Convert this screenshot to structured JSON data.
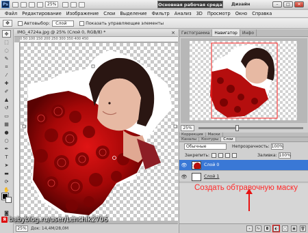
{
  "topbar": {
    "logo": "Ps",
    "zoom": "25%",
    "workspace": "Основная рабочая среда",
    "design": "Дизайн",
    "min": "–",
    "max": "□",
    "close": "✕"
  },
  "menu": [
    "Файл",
    "Редактирование",
    "Изображение",
    "Слои",
    "Выделение",
    "Фильтр",
    "Анализ",
    "3D",
    "Просмотр",
    "Окно",
    "Справка"
  ],
  "options": {
    "autoselect": "Автовыбор:",
    "autoselect_value": "Слой",
    "show_controls": "Показать управляющие элементы"
  },
  "document": {
    "tab": "IMG_4724a.jpg @ 25% (Слой 0, RGB/8) *",
    "close": "×",
    "ruler": "0   50   100   150   200   250   300   350   400   450",
    "zoom": "25%",
    "info": "Док: 14,4M/28,0M"
  },
  "watermark": {
    "badge": "Я",
    "text": "babyblog.ru/user/Lenchik2706"
  },
  "navigator": {
    "tabs": [
      "Гистограмма",
      "Навигатор",
      "Инфо"
    ],
    "active_tab": "Навигатор",
    "zoom": "25%",
    "zoom_fraction": 0.35
  },
  "layers": {
    "tabs": [
      "Коррекция",
      "Маски"
    ],
    "tabs2": [
      "Каналы",
      "Контуры",
      "Слои"
    ],
    "active_tab": "Слои",
    "blend_mode": "Обычные",
    "opacity_label": "Непрозрачность:",
    "opacity": "100%",
    "lock_label": "Закрепить:",
    "fill_label": "Заливка:",
    "fill": "100%",
    "items": [
      {
        "name": "Слой 0",
        "selected": true
      },
      {
        "name": "Слой 1",
        "selected": false
      }
    ]
  },
  "annotation": "Создать обтравочную маску",
  "colors": {
    "accent": "#3a78d6",
    "annotation": "#ff2a2a"
  }
}
